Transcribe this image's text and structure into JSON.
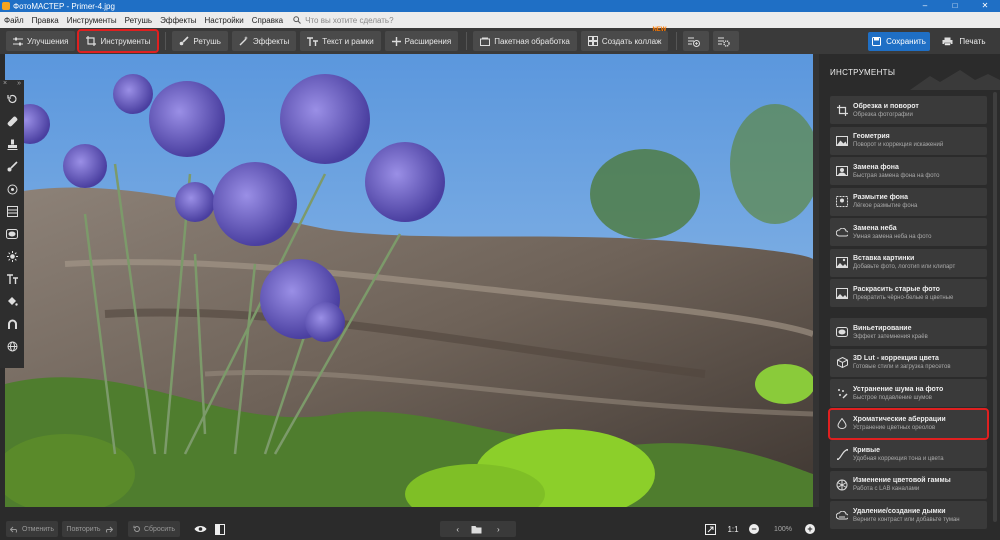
{
  "window": {
    "title": "ФотоМАСТЕР - Primer-4.jpg",
    "minimize": "–",
    "maximize": "□",
    "close": "✕"
  },
  "menu": {
    "items": [
      "Файл",
      "Правка",
      "Инструменты",
      "Ретушь",
      "Эффекты",
      "Настройки",
      "Справка"
    ],
    "search_placeholder": "Что вы хотите сделать?"
  },
  "toolbar": {
    "improve": "Улучшения",
    "tools": "Инструменты",
    "retouch": "Ретушь",
    "effects": "Эффекты",
    "text": "Текст и рамки",
    "extensions": "Расширения",
    "batch": "Пакетная обработка",
    "collage": "Создать коллаж",
    "collage_badge": "NEW",
    "save": "Сохранить",
    "print": "Печать"
  },
  "panel": {
    "title": "ИНСТРУМЕНТЫ",
    "tools": [
      {
        "title": "Обрезка и поворот",
        "desc": "Обрезка фотографии",
        "icon": "crop-icon"
      },
      {
        "title": "Геометрия",
        "desc": "Поворот и коррекция искажений",
        "icon": "geometry-icon"
      },
      {
        "title": "Замена фона",
        "desc": "Быстрая замена фона на фото",
        "icon": "background-icon"
      },
      {
        "title": "Размытие фона",
        "desc": "Лёгкое размытие фона",
        "icon": "blur-icon"
      },
      {
        "title": "Замена неба",
        "desc": "Умная замена неба на фото",
        "icon": "sky-icon"
      },
      {
        "title": "Вставка картинки",
        "desc": "Добавьте фото, логотип или клипарт",
        "icon": "insert-image-icon"
      },
      {
        "title": "Раскрасить старые фото",
        "desc": "Превратить чёрно-белые в цветные",
        "icon": "colorize-icon"
      },
      {
        "title": "Виньетирование",
        "desc": "Эффект затемнения краёв",
        "icon": "vignette-icon"
      },
      {
        "title": "3D Lut - коррекция цвета",
        "desc": "Готовые стили и загрузка пресетов",
        "icon": "lut-icon"
      },
      {
        "title": "Устранение шума на фото",
        "desc": "Быстрое подавление шумов",
        "icon": "denoise-icon"
      },
      {
        "title": "Хроматические аберрации",
        "desc": "Устранение цветных ореолов",
        "icon": "chromatic-icon"
      },
      {
        "title": "Кривые",
        "desc": "Удобная коррекция тона и цвета",
        "icon": "curves-icon"
      },
      {
        "title": "Изменение цветовой гаммы",
        "desc": "Работа с LAB каналами",
        "icon": "color-gamut-icon"
      },
      {
        "title": "Удаление/создание дымки",
        "desc": "Верните контраст или добавьте туман",
        "icon": "haze-icon"
      }
    ]
  },
  "bottom": {
    "undo": "Отменить",
    "redo": "Повторить",
    "reset": "Сбросить",
    "ratio": "1:1",
    "zoom": "100%",
    "zoom_out": "−",
    "zoom_in": "+"
  },
  "colors": {
    "accent": "#1f6fc5",
    "highlight": "#e02020",
    "new_badge": "#ff7a00"
  }
}
